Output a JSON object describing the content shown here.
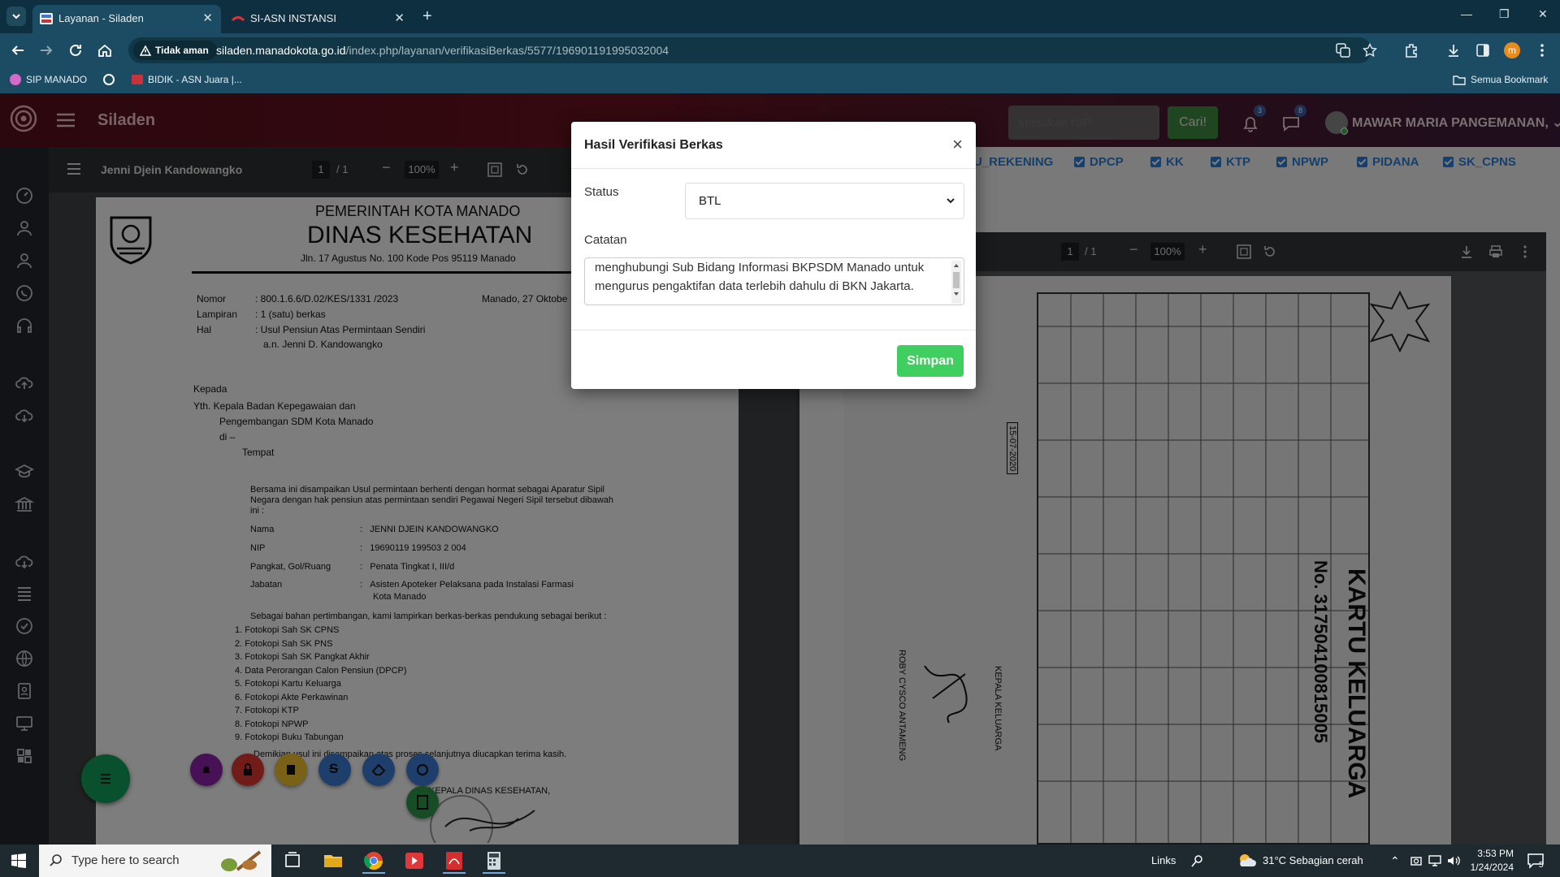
{
  "browser": {
    "tabs": [
      {
        "title": "Layanan - Siladen",
        "active": true
      },
      {
        "title": "SI-ASN INSTANSI",
        "active": false
      }
    ],
    "security_label": "Tidak aman",
    "url_host": "siladen.manadokota.go.id",
    "url_path": "/index.php/layanan/verifikasiBerkas/5577/196901191995032004",
    "profile_initial": "m",
    "bookmarks": [
      "SIP MANADO",
      "BIDIK - ASN Juara |..."
    ],
    "all_bookmarks": "Semua Bookmark"
  },
  "app": {
    "brand": "Siladen",
    "search_placeholder": "Masukan NIP",
    "search_button": "Cari!",
    "notif_count": "3",
    "message_count": "8",
    "user_name": "MAWAR MARIA PANGEMANAN,"
  },
  "left_pdf": {
    "file_name": "Jenni Djein Kandowangko",
    "page_current": "1",
    "page_total": "/ 1",
    "zoom": "100%",
    "letter": {
      "header1": "PEMERINTAH KOTA MANADO",
      "header2": "DINAS KESEHATAN",
      "address": "Jln. 17 Agustus No. 100  Kode Pos 95119 Manado",
      "nomor_label": "Nomor",
      "nomor_value": ":  800.1.6.6/D.02/KES/1331 /2023",
      "date": "Manado, 27  Oktobe",
      "lampiran_label": "Lampiran",
      "lampiran_value": ":  1 (satu) berkas",
      "hal_label": "Hal",
      "hal_value": ":  Usul Pensiun Atas Permintaan Sendiri",
      "hal_value2": "a.n. Jenni D. Kandowangko",
      "kepada": "Kepada",
      "yth": "Yth.   Kepala Badan Kepegawaian dan",
      "yth2": "Pengembangan SDM Kota Manado",
      "di": "di –",
      "tempat": "Tempat",
      "body1": "Bersama ini disampaikan Usul permintaan berhenti dengan hormat sebagai Aparatur Sipil",
      "body2": "Negara dengan hak pensiun  atas permintaan sendiri Pegawai Negeri Sipil tersebut dibawah",
      "body3": "ini :",
      "fields": [
        {
          "label": "Nama",
          "value": "JENNI DJEIN KANDOWANGKO"
        },
        {
          "label": "NIP",
          "value": "19690119 199503 2 004"
        },
        {
          "label": "Pangkat, Gol/Ruang",
          "value": "Penata Tingkat I, III/d"
        },
        {
          "label": "Jabatan",
          "value": "Asisten Apoteker Pelaksana pada Instalasi Farmasi"
        }
      ],
      "jabatan2": "Kota Manado",
      "intro_list": "Sebagai bahan pertimbangan, kami lampirkan berkas-berkas pendukung sebagai berikut :",
      "list": [
        "1.   Fotokopi Sah SK CPNS",
        "2.   Fotokopi Sah SK PNS",
        "3.   Fotokopi Sah SK Pangkat Akhir",
        "4.   Data Perorangan Calon Pensiun (DPCP)",
        "5.   Fotokopi Kartu Keluarga",
        "6.   Fotokopi Akte Perkawinan",
        "7.   Fotokopi KTP",
        "8.   Fotokopi NPWP",
        "9.   Fotokopi Buku Tabungan"
      ],
      "closing": "Demikian usul ini disampaikan atas proses selanjutnya diucapkan terima kasih.",
      "signature_title": "KEPALA DINAS KESEHATAN,"
    }
  },
  "checklist": [
    "U_REKENING",
    "DPCP",
    "KK",
    "KTP",
    "NPWP",
    "PIDANA",
    "SK_CPNS"
  ],
  "right_pdf": {
    "page_current": "1",
    "page_total": "/ 1",
    "zoom": "100%",
    "doc_title": "KARTU KELUARGA",
    "doc_number": "No. 317504100815005",
    "head_label": "KEPALA KELUARGA",
    "head_name": "ROBY CYSCO ANTAMENG",
    "date": "15-07-2020"
  },
  "modal": {
    "title": "Hasil Verifikasi Berkas",
    "close": "×",
    "status_label": "Status",
    "status_value": "BTL",
    "catatan_label": "Catatan",
    "catatan_line1": "menghubungi Sub Bidang Informasi BKPSDM Manado untuk",
    "catatan_line2": "mengurus pengaktifan data terlebih dahulu di BKN Jakarta.",
    "save_button": "Simpan"
  },
  "taskbar": {
    "search_placeholder": "Type here to search",
    "links": "Links",
    "weather": "31°C  Sebagian cerah",
    "time": "3:53 PM",
    "date": "1/24/2024",
    "notif_count": "5"
  },
  "colors": {
    "accent_green": "#3fcf5e",
    "checkbox_blue": "#2f7fd6",
    "header_maroon": "#6b1220",
    "tab_teal": "#1c4c63"
  }
}
